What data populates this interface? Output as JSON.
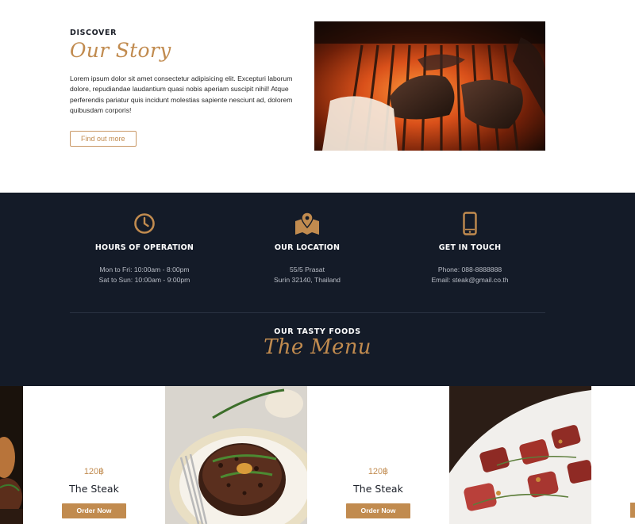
{
  "story": {
    "eyebrow": "DISCOVER",
    "title": "Our Story",
    "body": "Lorem ipsum dolor sit amet consectetur adipisicing elit. Excepturi laborum dolore, repudiandae laudantium quasi nobis aperiam suscipit nihil! Atque perferendis pariatur quis incidunt molestias sapiente nesciunt ad, dolorem quibusdam corporis!",
    "cta_label": "Find out more"
  },
  "info": {
    "columns": [
      {
        "icon": "clock-icon",
        "title": "HOURS OF OPERATION",
        "line1": "Mon to Fri: 10:00am - 8:00pm",
        "line2": "Sat to Sun: 10:00am - 9:00pm"
      },
      {
        "icon": "map-icon",
        "title": "OUR LOCATION",
        "line1": "55/5 Prasat",
        "line2": "Surin 32140, Thailand"
      },
      {
        "icon": "phone-icon",
        "title": "GET IN TOUCH",
        "line1": "Phone: 088-8888888",
        "line2": "Email: steak@gmail.co.th"
      }
    ]
  },
  "menu": {
    "eyebrow": "OUR TASTY FOODS",
    "title": "The Menu",
    "items": [
      {
        "price": "120฿",
        "name": "The Steak",
        "button": "Order Now"
      },
      {
        "price": "120฿",
        "name": "The Steak",
        "button": "Order Now"
      }
    ]
  },
  "colors": {
    "accent": "#c18b4f",
    "dark": "#141b28",
    "white": "#ffffff"
  }
}
